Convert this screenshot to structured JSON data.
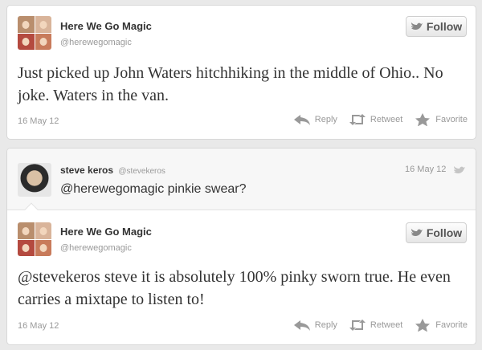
{
  "tweets": [
    {
      "name": "Here We Go Magic",
      "handle": "@herewegomagic",
      "follow_label": "Follow",
      "text": "Just picked up John Waters hitchhiking in the middle of Ohio.. No joke. Waters in the van.",
      "date": "16 May 12"
    }
  ],
  "reply_to": {
    "name": "steve keros",
    "handle": "@stevekeros",
    "date": "16 May 12",
    "text": "@herewegomagic pinkie swear?"
  },
  "reply": {
    "name": "Here We Go Magic",
    "handle": "@herewegomagic",
    "follow_label": "Follow",
    "text": "@stevekeros steve it is absolutely 100% pinky sworn true. He even carries a mixtape to listen to!",
    "date": "16 May 12"
  },
  "actions": {
    "reply": "Reply",
    "retweet": "Retweet",
    "favorite": "Favorite"
  },
  "colors": {
    "action_gray": "#999999",
    "card_border": "#d8d8d8"
  }
}
